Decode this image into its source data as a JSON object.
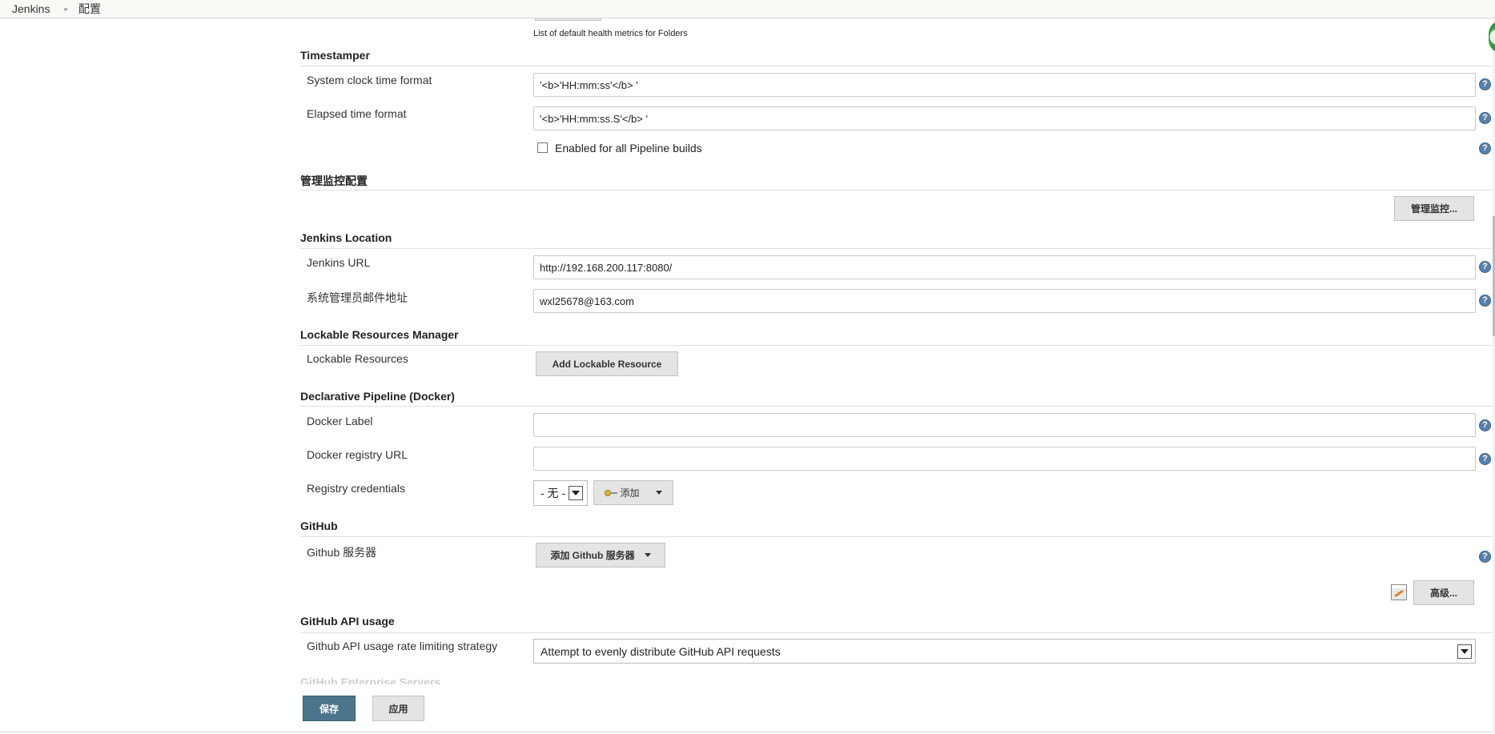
{
  "breadcrumb": {
    "root": "Jenkins",
    "current": "配置"
  },
  "folders_health": {
    "hint": "List of default health metrics for Folders"
  },
  "timestamper": {
    "title": "Timestamper",
    "system_clock_label": "System clock time format",
    "system_clock_value": "'<b>'HH:mm:ss'</b> '",
    "elapsed_label": "Elapsed time format",
    "elapsed_value": "'<b>'HH:mm:ss.S'</b> '",
    "pipeline_checkbox_label": "Enabled for all Pipeline builds",
    "pipeline_checkbox_checked": false
  },
  "monitor": {
    "title": "管理监控配置",
    "button_label": "管理监控..."
  },
  "jenkins_location": {
    "title": "Jenkins Location",
    "url_label": "Jenkins URL",
    "url_value": "http://192.168.200.117:8080/",
    "email_label": "系统管理员邮件地址",
    "email_value": "wxl25678@163.com"
  },
  "lockable": {
    "title": "Lockable Resources Manager",
    "resources_label": "Lockable Resources",
    "add_button": "Add Lockable Resource"
  },
  "docker": {
    "title": "Declarative Pipeline (Docker)",
    "label_label": "Docker Label",
    "label_value": "",
    "registry_url_label": "Docker registry URL",
    "registry_url_value": "",
    "credentials_label": "Registry credentials",
    "credentials_selected": "- 无 -",
    "add_button": "添加"
  },
  "github": {
    "title": "GitHub",
    "servers_label": "Github 服务器",
    "add_server_button": "添加 Github 服务器",
    "advanced_button": "高级..."
  },
  "github_api": {
    "title": "GitHub API usage",
    "strategy_label": "Github API usage rate limiting strategy",
    "strategy_selected": "Attempt to evenly distribute GitHub API requests"
  },
  "enterprise": {
    "title": "GitHub Enterprise Servers"
  },
  "footer": {
    "save": "保存",
    "apply": "应用"
  },
  "icons": {
    "help": "question-circle-icon",
    "key": "key-icon",
    "notepad": "notepad-icon",
    "help_glyph": "?"
  },
  "colors": {
    "save_button": "#4b758b",
    "help_icon": "#5780ad"
  }
}
